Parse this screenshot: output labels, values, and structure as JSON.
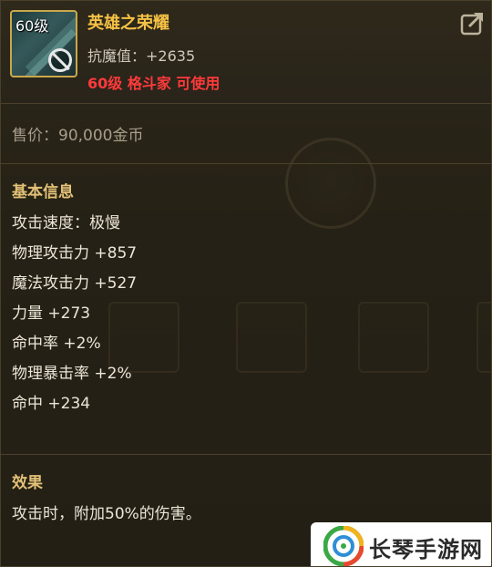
{
  "item": {
    "level_badge": "60级",
    "name": "英雄之荣耀",
    "resist": "抗魔值：+2635",
    "requirement": "60级 格斗家 可使用"
  },
  "price": "售价：90,000金币",
  "basic_info": {
    "title": "基本信息",
    "stats": [
      "攻击速度：极慢",
      "物理攻击力 +857",
      "魔法攻击力 +527",
      "力量 +273",
      "命中率 +2%",
      "物理暴击率 +2%",
      "命中 +234"
    ]
  },
  "effect": {
    "title": "效果",
    "text": "攻击时，附加50%的伤害。"
  },
  "watermark": {
    "text": "长琴手游网"
  },
  "colors": {
    "item_name": "#f6c245",
    "requirement": "#ff3a3a",
    "section_title": "#e3c277"
  }
}
